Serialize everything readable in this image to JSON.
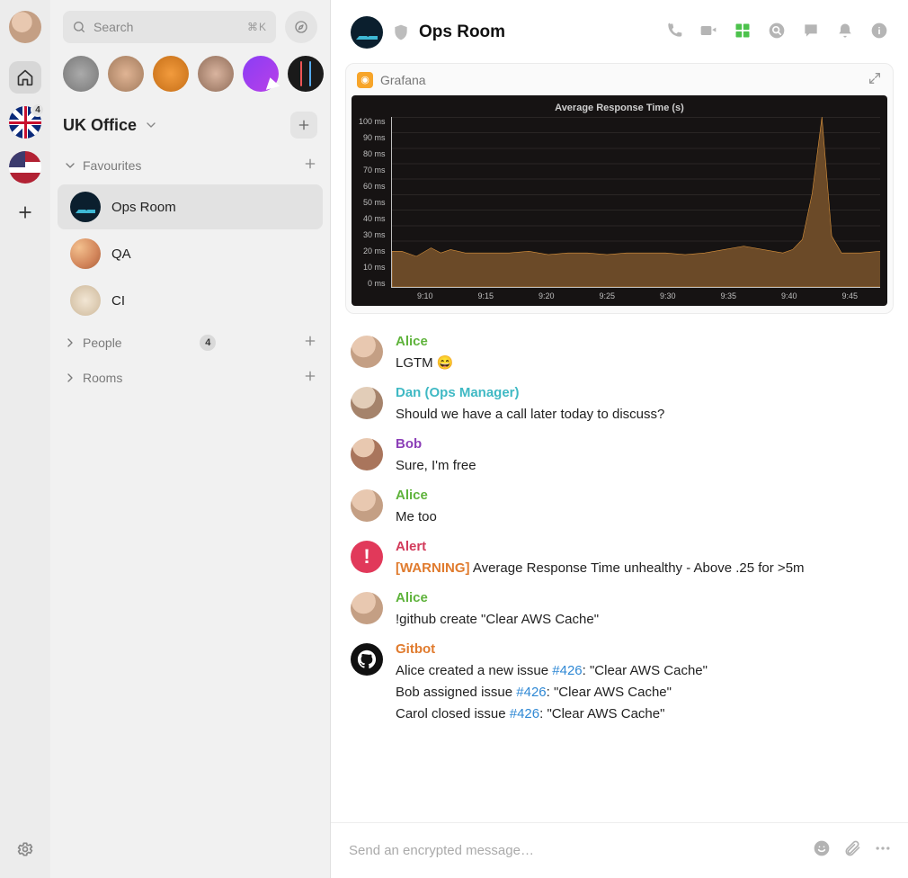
{
  "search": {
    "placeholder": "Search",
    "shortcut": "⌘K"
  },
  "space": {
    "name": "UK Office",
    "badge": "4"
  },
  "sections": {
    "favourites": {
      "label": "Favourites"
    },
    "people": {
      "label": "People",
      "count": "4"
    },
    "rooms": {
      "label": "Rooms"
    }
  },
  "fav_rooms": [
    {
      "name": "Ops Room",
      "av": "ops",
      "active": true
    },
    {
      "name": "QA",
      "av": "qa"
    },
    {
      "name": "CI",
      "av": "ci"
    }
  ],
  "room_header": {
    "title": "Ops Room"
  },
  "widget": {
    "name": "Grafana"
  },
  "chart_data": {
    "type": "area",
    "title": "Average Response Time (s)",
    "ylabel": "",
    "xlabel": "",
    "ylim": [
      0,
      100
    ],
    "y_ticks": [
      "100 ms",
      "90 ms",
      "80 ms",
      "70 ms",
      "60 ms",
      "50 ms",
      "40 ms",
      "30 ms",
      "20 ms",
      "10 ms",
      "0 ms"
    ],
    "x_ticks": [
      "9:10",
      "9:15",
      "9:20",
      "9:25",
      "9:30",
      "9:35",
      "9:40",
      "9:45"
    ],
    "x": [
      0,
      2,
      5,
      8,
      10,
      12,
      15,
      18,
      20,
      24,
      28,
      32,
      36,
      40,
      44,
      48,
      52,
      56,
      60,
      64,
      68,
      72,
      76,
      80,
      82,
      84,
      86,
      88,
      90,
      92,
      96,
      100
    ],
    "values": [
      21,
      21,
      18,
      23,
      20,
      22,
      20,
      20,
      20,
      20,
      21,
      19,
      20,
      20,
      19,
      20,
      20,
      20,
      19,
      20,
      22,
      24,
      22,
      20,
      22,
      28,
      55,
      100,
      30,
      20,
      20,
      21
    ]
  },
  "messages": [
    {
      "id": "m1",
      "user": "Alice",
      "cls": "alice",
      "av": "alice",
      "lines": [
        {
          "t": "text",
          "v": "LGTM 😄"
        }
      ]
    },
    {
      "id": "m2",
      "user": "Dan (Ops Manager)",
      "cls": "dan",
      "av": "dan",
      "lines": [
        {
          "t": "text",
          "v": "Should we have a call later today to discuss?"
        }
      ]
    },
    {
      "id": "m3",
      "user": "Bob",
      "cls": "bob",
      "av": "bob",
      "lines": [
        {
          "t": "text",
          "v": "Sure, I'm free"
        }
      ]
    },
    {
      "id": "m4",
      "user": "Alice",
      "cls": "alice",
      "av": "alice",
      "lines": [
        {
          "t": "text",
          "v": "Me too"
        }
      ]
    },
    {
      "id": "m5",
      "user": "Alert",
      "cls": "alert",
      "av": "alert",
      "lines": [
        {
          "t": "warn",
          "tag": "[WARNING]",
          "v": " Average Response Time unhealthy - Above .25 for >5m"
        }
      ]
    },
    {
      "id": "m6",
      "user": "Alice",
      "cls": "alice",
      "av": "alice",
      "lines": [
        {
          "t": "text",
          "v": "!github create \"Clear AWS Cache\""
        }
      ]
    },
    {
      "id": "m7",
      "user": "Gitbot",
      "cls": "gitbot",
      "av": "gitbot",
      "lines": [
        {
          "t": "issue",
          "pre": "Alice created a new issue ",
          "link": "#426",
          "post": ": \"Clear AWS Cache\""
        },
        {
          "t": "issue",
          "pre": "Bob assigned issue ",
          "link": "#426",
          "post": ": \"Clear AWS Cache\""
        },
        {
          "t": "issue",
          "pre": "Carol closed issue ",
          "link": "#426",
          "post": ": \"Clear AWS Cache\""
        }
      ]
    }
  ],
  "composer": {
    "placeholder": "Send an encrypted message…"
  }
}
